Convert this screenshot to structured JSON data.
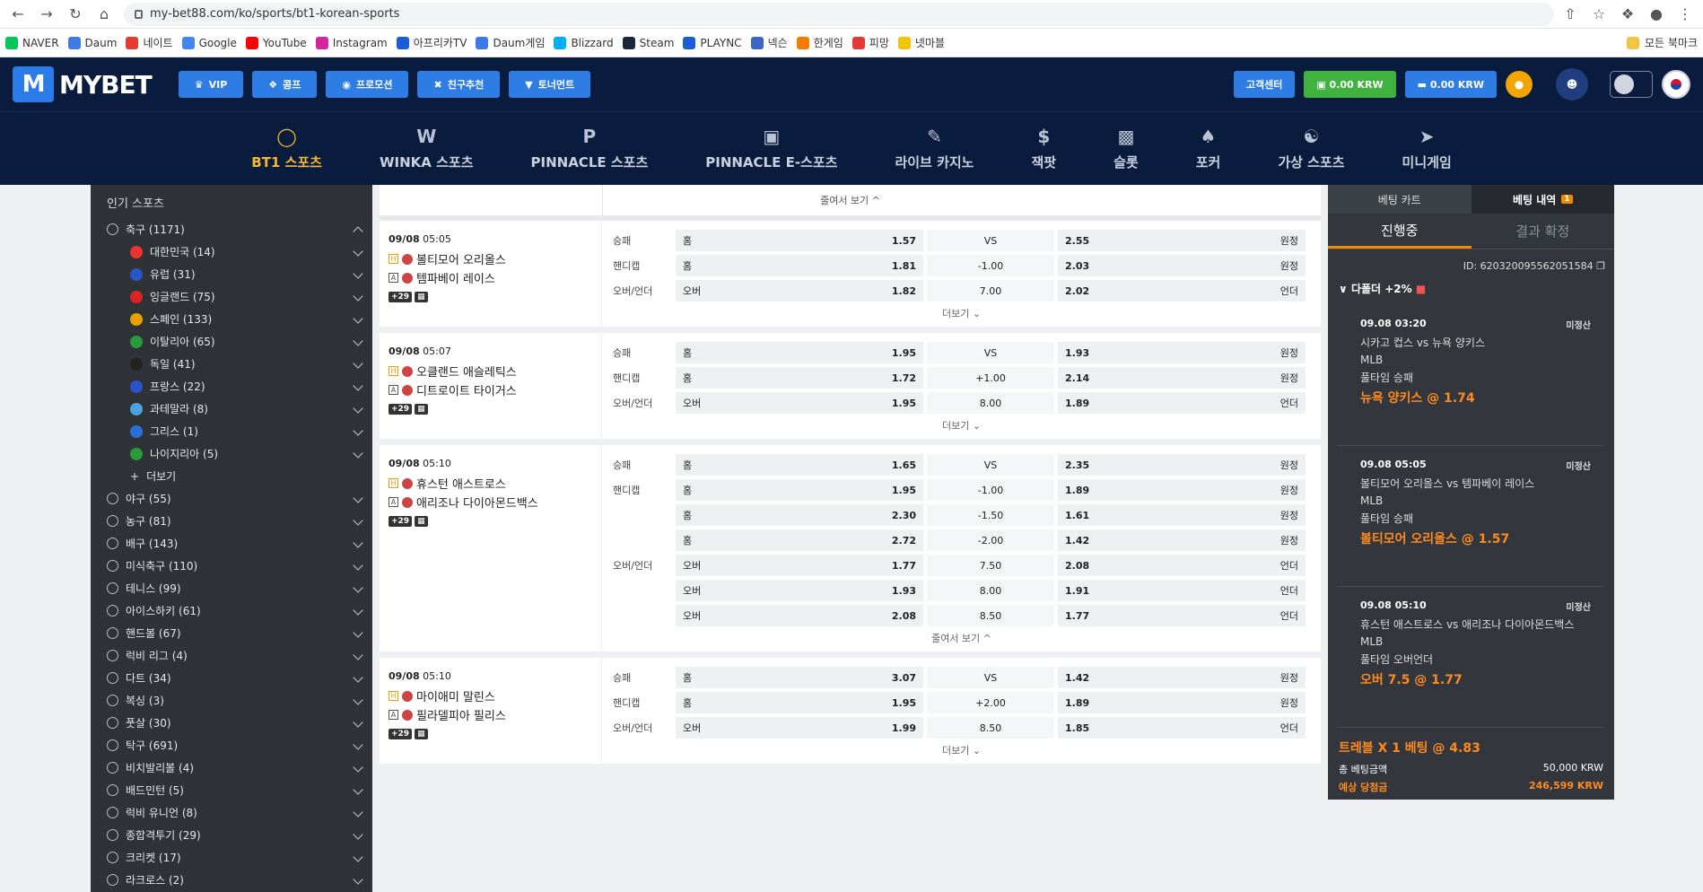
{
  "browser": {
    "url": "my-bet88.com/ko/sports/bt1-korean-sports",
    "bookmarks": [
      "NAVER",
      "Daum",
      "네이트",
      "Google",
      "YouTube",
      "Instagram",
      "아프리카TV",
      "Daum게임",
      "Blizzard",
      "Steam",
      "PLAYNC",
      "넥슨",
      "한게임",
      "피망",
      "넷마블"
    ],
    "bookmarks_right": "모든 북마크"
  },
  "header": {
    "logo": "MYBET",
    "promo": [
      "VIP",
      "콤프",
      "프로모션",
      "친구추천",
      "토너먼트"
    ],
    "cs": "고객센터",
    "balance1": "0.00 KRW",
    "balance2": "0.00 KRW"
  },
  "nav": [
    "BT1 스포츠",
    "WINKA 스포츠",
    "PINNACLE 스포츠",
    "PINNACLE E-스포츠",
    "라이브 카지노",
    "잭팟",
    "슬롯",
    "포커",
    "가상 스포츠",
    "미니게임"
  ],
  "sidebar": {
    "title": "인기 스포츠",
    "soccer": "축구 (1171)",
    "subs": [
      "대한민국 (14)",
      "유럽 (31)",
      "잉글랜드 (75)",
      "스페인 (133)",
      "이탈리아 (65)",
      "독일 (41)",
      "프랑스 (22)",
      "과테말라 (8)",
      "그리스 (1)",
      "나이지리아 (5)"
    ],
    "more": "더보기",
    "sports": [
      "야구 (55)",
      "농구 (81)",
      "배구 (143)",
      "미식축구 (110)",
      "테니스 (99)",
      "아이스하키 (61)",
      "핸드볼 (67)",
      "럭비 리그 (4)",
      "다트 (34)",
      "복싱 (3)",
      "풋살 (30)",
      "탁구 (691)",
      "비치발리볼 (4)",
      "배드민턴 (5)",
      "럭비 유니언 (8)",
      "종합격투기 (29)",
      "크리켓 (17)",
      "라크로스 (2)"
    ]
  },
  "main": {
    "collapse": "줄여서 보기",
    "more": "더보기",
    "matches": [
      {
        "date": "09/08",
        "time": "05:05",
        "home": "볼티모어 오리올스",
        "away": "템파베이 레이스",
        "count": "+29",
        "rows": [
          [
            "승패",
            "홈",
            "1.57",
            "VS",
            "2.55",
            "원정"
          ],
          [
            "핸디캡",
            "홈",
            "1.81",
            "-1.00",
            "2.03",
            "원정"
          ],
          [
            "오버/언더",
            "오버",
            "1.82",
            "7.00",
            "2.02",
            "언더"
          ]
        ],
        "footer": "더보기"
      },
      {
        "date": "09/08",
        "time": "05:07",
        "home": "오클랜드 애슬레틱스",
        "away": "디트로이트 타이거스",
        "count": "+29",
        "rows": [
          [
            "승패",
            "홈",
            "1.95",
            "VS",
            "1.93",
            "원정"
          ],
          [
            "핸디캡",
            "홈",
            "1.72",
            "+1.00",
            "2.14",
            "원정"
          ],
          [
            "오버/언더",
            "오버",
            "1.95",
            "8.00",
            "1.89",
            "언더"
          ]
        ],
        "footer": "더보기"
      },
      {
        "date": "09/08",
        "time": "05:10",
        "home": "휴스턴 애스트로스",
        "away": "애리조나 다이아몬드백스",
        "count": "+29",
        "rows": [
          [
            "승패",
            "홈",
            "1.65",
            "VS",
            "2.35",
            "원정"
          ],
          [
            "핸디캡",
            "홈",
            "1.95",
            "-1.00",
            "1.89",
            "원정"
          ],
          [
            "",
            "홈",
            "2.30",
            "-1.50",
            "1.61",
            "원정"
          ],
          [
            "",
            "홈",
            "2.72",
            "-2.00",
            "1.42",
            "원정"
          ],
          [
            "오버/언더",
            "오버",
            "1.77",
            "7.50",
            "2.08",
            "언더"
          ],
          [
            "",
            "오버",
            "1.93",
            "8.00",
            "1.91",
            "언더"
          ],
          [
            "",
            "오버",
            "2.08",
            "8.50",
            "1.77",
            "언더"
          ]
        ],
        "footer": "줄여서 보기"
      },
      {
        "date": "09/08",
        "time": "05:10",
        "home": "마이애미 말린스",
        "away": "필라델피아 필리스",
        "count": "+29",
        "rows": [
          [
            "승패",
            "홈",
            "3.07",
            "VS",
            "1.42",
            "원정"
          ],
          [
            "핸디캡",
            "홈",
            "1.95",
            "+2.00",
            "1.89",
            "원정"
          ],
          [
            "오버/언더",
            "오버",
            "1.99",
            "8.50",
            "1.85",
            "언더"
          ]
        ],
        "footer": "더보기"
      }
    ]
  },
  "betslip": {
    "tab1": "베팅 카트",
    "tab2": "베팅 내역",
    "tab2_badge": "1",
    "sub1": "진행중",
    "sub2": "결과 확정",
    "id": "ID: 620320095562051584",
    "multi": "다폴더 +2%",
    "items": [
      {
        "date": "09.08",
        "time": "03:20",
        "status": "미정산",
        "match": "시카고 컵스 vs 뉴욕 양키스",
        "league": "MLB",
        "market": "풀타임 승패",
        "pick": "뉴욕 양키스 @ 1.74"
      },
      {
        "date": "09.08",
        "time": "05:05",
        "status": "미정산",
        "match": "볼티모어 오리올스 vs 템파베이 레이스",
        "league": "MLB",
        "market": "풀타임 승패",
        "pick": "볼티모어 오리올스 @ 1.57"
      },
      {
        "date": "09.08",
        "time": "05:10",
        "status": "미정산",
        "match": "휴스턴 애스트로스 vs 애리조나 다이아몬드백스",
        "league": "MLB",
        "market": "풀타임 오버언더",
        "pick": "오버 7.5 @ 1.77"
      }
    ],
    "summary": "트레블 X 1 베팅 @ 4.83",
    "total_label": "총 베팅금액",
    "total": "50,000 KRW",
    "expected_label": "예상 당첨금",
    "expected": "246,599 KRW"
  }
}
